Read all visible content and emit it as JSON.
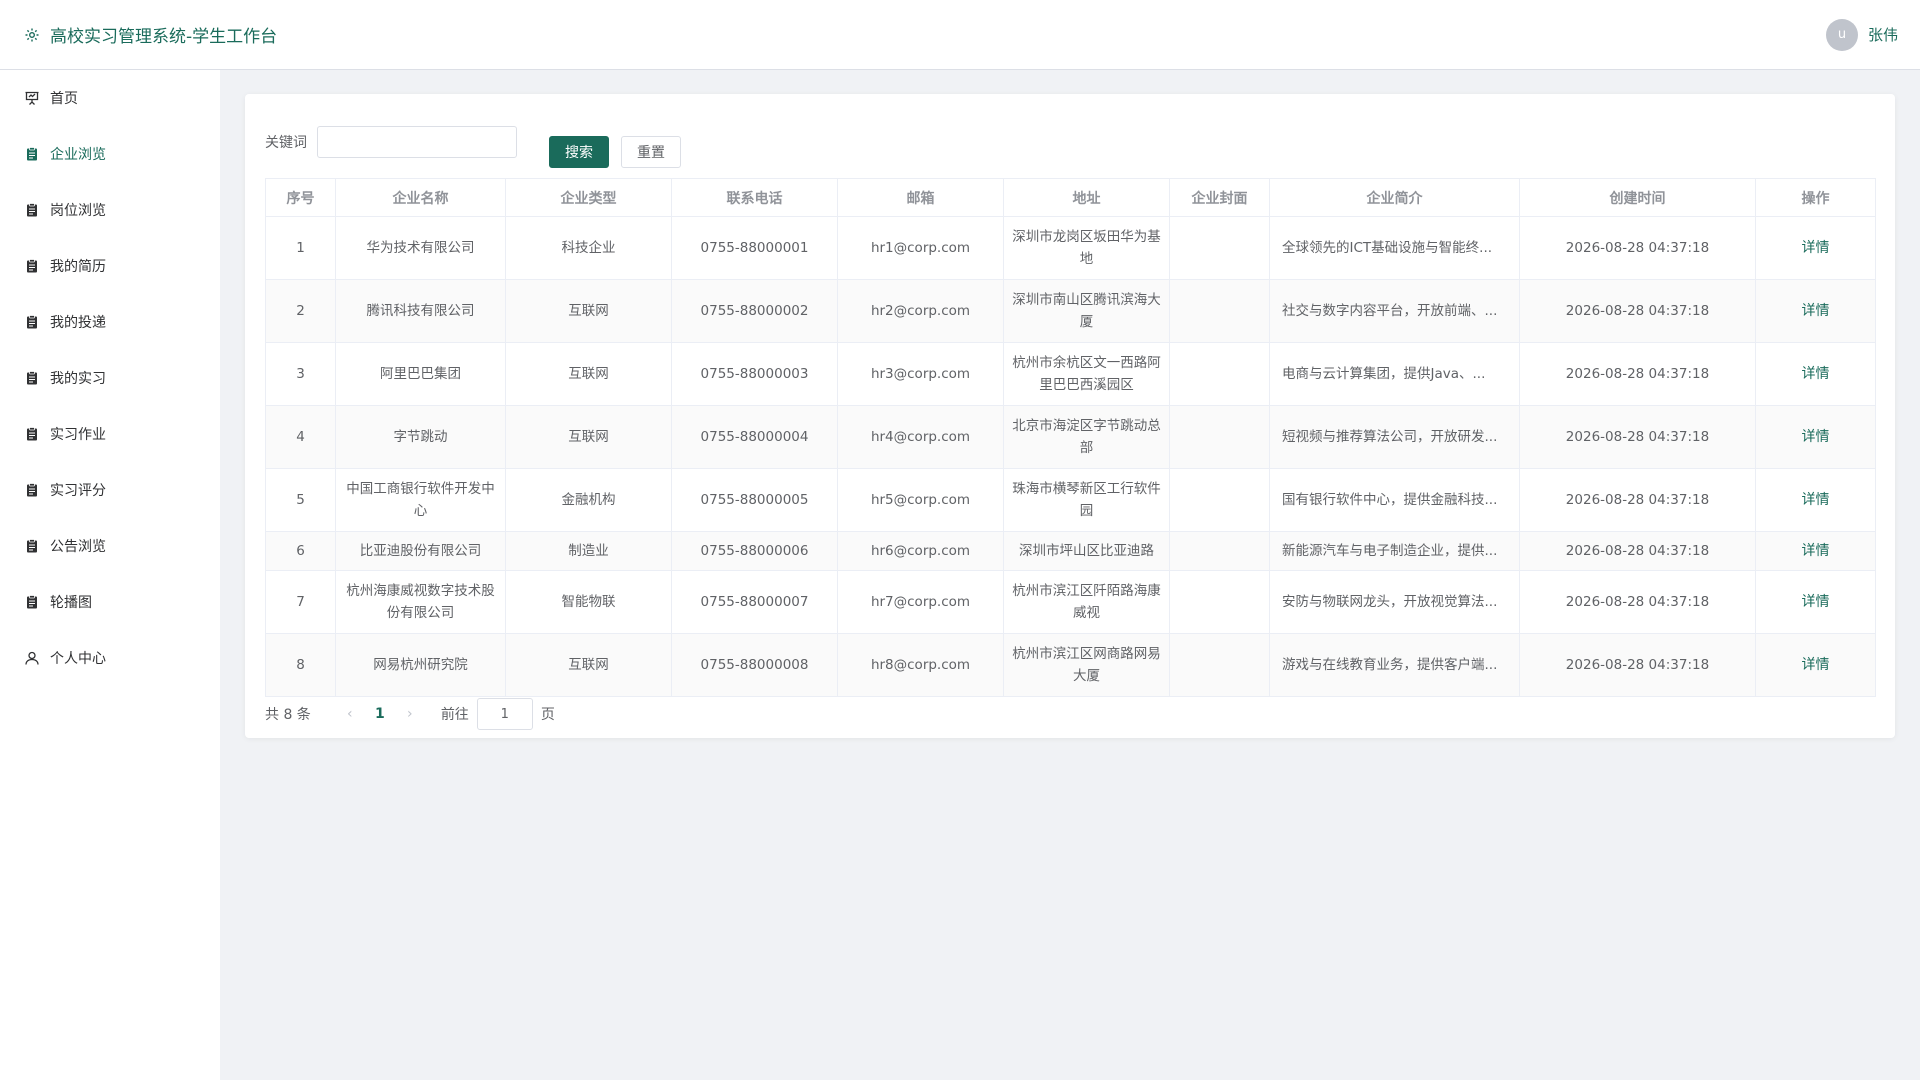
{
  "header": {
    "title": "高校实习管理系统-学生工作台",
    "avatar_letter": "u",
    "username": "张伟"
  },
  "colors": {
    "accent": "#1a6b5b",
    "border": "#ebeef5",
    "muted": "#909399"
  },
  "sidebar": {
    "items": [
      {
        "label": "首页",
        "icon": "presentation-icon"
      },
      {
        "label": "企业浏览",
        "icon": "clipboard-icon",
        "active": true
      },
      {
        "label": "岗位浏览",
        "icon": "clipboard-icon"
      },
      {
        "label": "我的简历",
        "icon": "clipboard-icon"
      },
      {
        "label": "我的投递",
        "icon": "clipboard-icon"
      },
      {
        "label": "我的实习",
        "icon": "clipboard-icon"
      },
      {
        "label": "实习作业",
        "icon": "clipboard-icon"
      },
      {
        "label": "实习评分",
        "icon": "clipboard-icon"
      },
      {
        "label": "公告浏览",
        "icon": "clipboard-icon"
      },
      {
        "label": "轮播图",
        "icon": "clipboard-icon"
      },
      {
        "label": "个人中心",
        "icon": "user-icon"
      }
    ]
  },
  "search": {
    "keyword_label": "关键词",
    "keyword_value": "",
    "search_label": "搜索",
    "reset_label": "重置"
  },
  "table": {
    "columns": [
      "序号",
      "企业名称",
      "企业类型",
      "联系电话",
      "邮箱",
      "地址",
      "企业封面",
      "企业简介",
      "创建时间",
      "操作"
    ],
    "rows": [
      {
        "no": "1",
        "name": "华为技术有限公司",
        "type": "科技企业",
        "phone": "0755-88000001",
        "email": "hr1@corp.com",
        "addr": "深圳市龙岗区坂田华为基地",
        "cover": "",
        "intro": "全球领先的ICT基础设施与智能终...",
        "created": "2026-08-28 04:37:18",
        "action": "详情"
      },
      {
        "no": "2",
        "name": "腾讯科技有限公司",
        "type": "互联网",
        "phone": "0755-88000002",
        "email": "hr2@corp.com",
        "addr": "深圳市南山区腾讯滨海大厦",
        "cover": "",
        "intro": "社交与数字内容平台，开放前端、...",
        "created": "2026-08-28 04:37:18",
        "action": "详情"
      },
      {
        "no": "3",
        "name": "阿里巴巴集团",
        "type": "互联网",
        "phone": "0755-88000003",
        "email": "hr3@corp.com",
        "addr": "杭州市余杭区文一西路阿里巴巴西溪园区",
        "cover": "",
        "intro": "电商与云计算集团，提供Java、...",
        "created": "2026-08-28 04:37:18",
        "action": "详情"
      },
      {
        "no": "4",
        "name": "字节跳动",
        "type": "互联网",
        "phone": "0755-88000004",
        "email": "hr4@corp.com",
        "addr": "北京市海淀区字节跳动总部",
        "cover": "",
        "intro": "短视频与推荐算法公司，开放研发...",
        "created": "2026-08-28 04:37:18",
        "action": "详情"
      },
      {
        "no": "5",
        "name": "中国工商银行软件开发中心",
        "type": "金融机构",
        "phone": "0755-88000005",
        "email": "hr5@corp.com",
        "addr": "珠海市横琴新区工行软件园",
        "cover": "",
        "intro": "国有银行软件中心，提供金融科技...",
        "created": "2026-08-28 04:37:18",
        "action": "详情"
      },
      {
        "no": "6",
        "name": "比亚迪股份有限公司",
        "type": "制造业",
        "phone": "0755-88000006",
        "email": "hr6@corp.com",
        "addr": "深圳市坪山区比亚迪路",
        "cover": "",
        "intro": "新能源汽车与电子制造企业，提供...",
        "created": "2026-08-28 04:37:18",
        "action": "详情",
        "short": true
      },
      {
        "no": "7",
        "name": "杭州海康威视数字技术股份有限公司",
        "type": "智能物联",
        "phone": "0755-88000007",
        "email": "hr7@corp.com",
        "addr": "杭州市滨江区阡陌路海康威视",
        "cover": "",
        "intro": "安防与物联网龙头，开放视觉算法...",
        "created": "2026-08-28 04:37:18",
        "action": "详情"
      },
      {
        "no": "8",
        "name": "网易杭州研究院",
        "type": "互联网",
        "phone": "0755-88000008",
        "email": "hr8@corp.com",
        "addr": "杭州市滨江区网商路网易大厦",
        "cover": "",
        "intro": "游戏与在线教育业务，提供客户端...",
        "created": "2026-08-28 04:37:18",
        "action": "详情"
      }
    ]
  },
  "pagination": {
    "total_text": "共 8 条",
    "prev": "‹",
    "current": "1",
    "next": "›",
    "goto_label": "前往",
    "goto_value": "1",
    "page_suffix": "页"
  }
}
